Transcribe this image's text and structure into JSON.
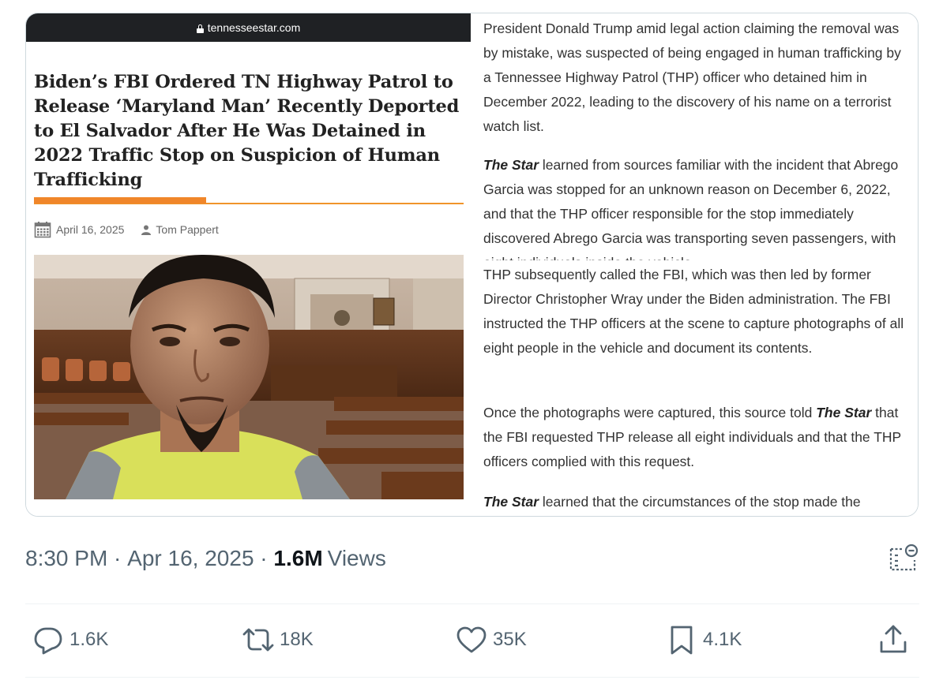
{
  "article_card": {
    "site": "tennesseestar.com",
    "headline": "Biden’s FBI Ordered TN Highway Patrol to Release ‘Maryland Man’ Recently Deported to El Salvador After He Was Detained in 2022 Traffic Stop on Suspicion of Human Trafficking",
    "date": "April 16, 2025",
    "author": "Tom Pappert",
    "accent_color": "#f0862a",
    "paragraphs": {
      "p1": "President Donald Trump amid legal action claiming the removal was by mistake, was suspected of being engaged in human trafficking by a Tennessee Highway Patrol (THP) officer who detained him in December 2022, leading to the discovery of his name on a terrorist watch list.",
      "p2_lead": "The Star",
      "p2_rest": " learned from sources familiar with the incident that Abrego Garcia was stopped for an unknown reason on December 6, 2022, and that the THP officer responsible for the stop immediately discovered Abrego Garcia was transporting seven passengers, with eight individuals inside the vehicle.",
      "p3": "THP subsequently called the FBI, which was then led by former Director Christopher Wray under the Biden administration. The FBI instructed the THP officers at the scene to capture photographs of all eight people in the vehicle and document its contents.",
      "p4_start": "Once the photographs were captured, this source told ",
      "p4_lead": "The Star",
      "p4_rest": " that the FBI requested THP release all eight individuals and that the THP officers complied with this request.",
      "p5_lead": "The Star",
      "p5_rest": " learned that the circumstances of the stop made the"
    }
  },
  "tweet_meta": {
    "time": "8:30 PM",
    "sep1": " · ",
    "date": "Apr 16, 2025",
    "sep2": " · ",
    "views_count": "1.6M",
    "views_label": "Views"
  },
  "actions": {
    "reply": "1.6K",
    "retweet": "18K",
    "like": "35K",
    "bookmark": "4.1K"
  },
  "icons": {
    "reply": "reply-icon",
    "retweet": "retweet-icon",
    "like": "heart-icon",
    "bookmark": "bookmark-icon",
    "share": "share-icon",
    "analytics": "analytics-icon",
    "lock": "lock-icon",
    "calendar": "calendar-icon",
    "person": "person-icon"
  }
}
